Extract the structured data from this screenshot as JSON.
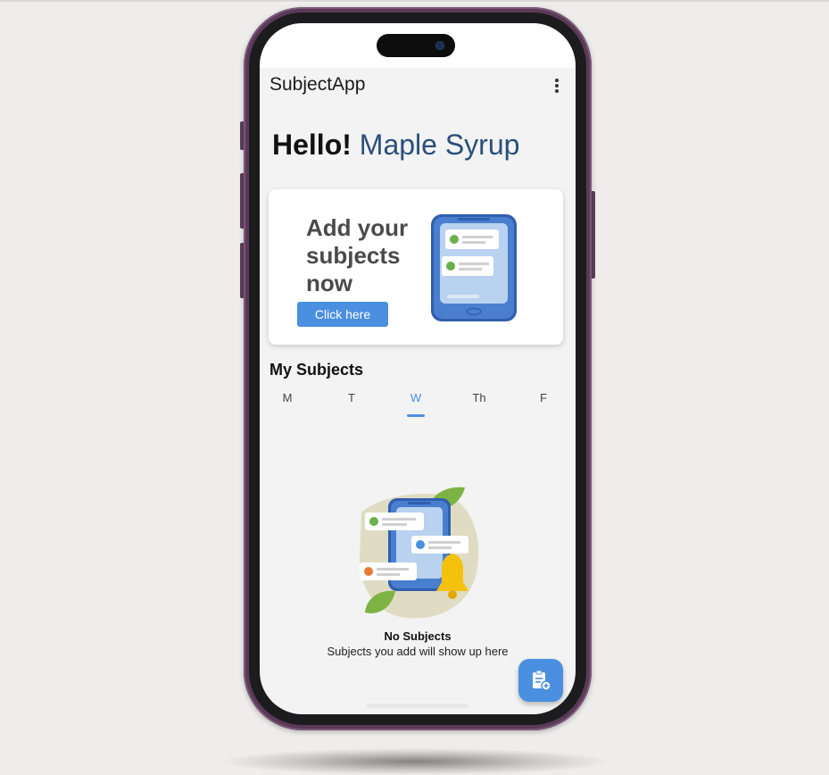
{
  "app": {
    "title": "SubjectApp"
  },
  "greeting": {
    "hello": "Hello!",
    "name": "Maple Syrup"
  },
  "promo_card": {
    "text": "Add your subjects now",
    "button_label": "Click here"
  },
  "section": {
    "title": "My Subjects"
  },
  "day_tabs": [
    {
      "label": "M",
      "active": false
    },
    {
      "label": "T",
      "active": false
    },
    {
      "label": "W",
      "active": true
    },
    {
      "label": "Th",
      "active": false
    },
    {
      "label": "F",
      "active": false
    }
  ],
  "empty_state": {
    "title": "No Subjects",
    "subtitle": "Subjects you add will show up here"
  },
  "icons": {
    "menu": "more-vert-icon",
    "fab": "add-clipboard-icon"
  },
  "colors": {
    "accent": "#4a8fe0",
    "name_text": "#2a4f7a",
    "frame": "#5a3a57",
    "screen_bg": "#f3f3f3"
  }
}
